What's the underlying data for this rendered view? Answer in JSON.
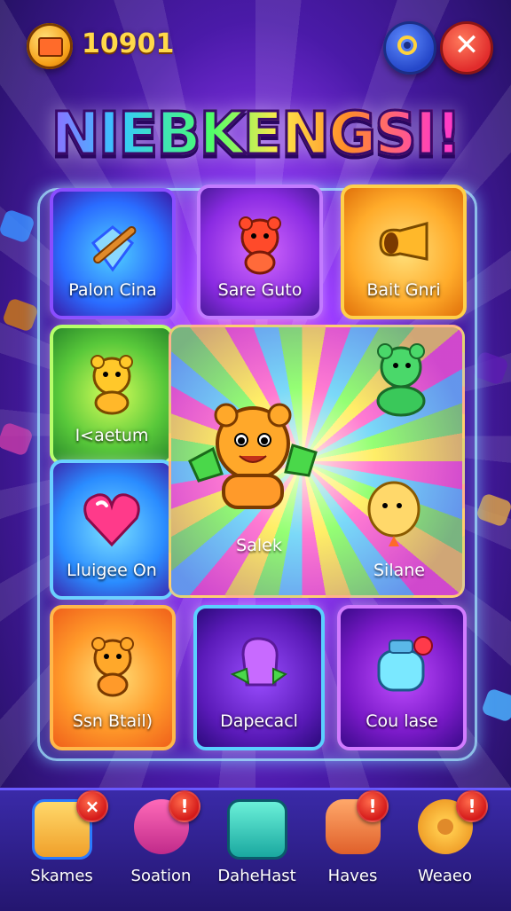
{
  "header": {
    "coins": "10901"
  },
  "title": "NIEBKENGSI!",
  "tiles": [
    {
      "label": "Palon Cina"
    },
    {
      "label": "Sare Guto"
    },
    {
      "label": "Bait Gnri"
    },
    {
      "label": "I<aetum"
    },
    {
      "label": "Lluigee On"
    },
    {
      "label": "Ssn Btail)"
    },
    {
      "label": "Dapecacl"
    },
    {
      "label": "Cou lase"
    }
  ],
  "center": {
    "tag": "Salek",
    "side_label": "Silane"
  },
  "nav": [
    {
      "label": "Skames",
      "badge": "×"
    },
    {
      "label": "Soation",
      "badge": "!"
    },
    {
      "label": "DaheHast",
      "badge": ""
    },
    {
      "label": "Haves",
      "badge": "!"
    },
    {
      "label": "Weaeo",
      "badge": "!"
    }
  ],
  "colors": {
    "coin_text": "#ffd94a",
    "nav_bg": "#2e1f8a"
  }
}
